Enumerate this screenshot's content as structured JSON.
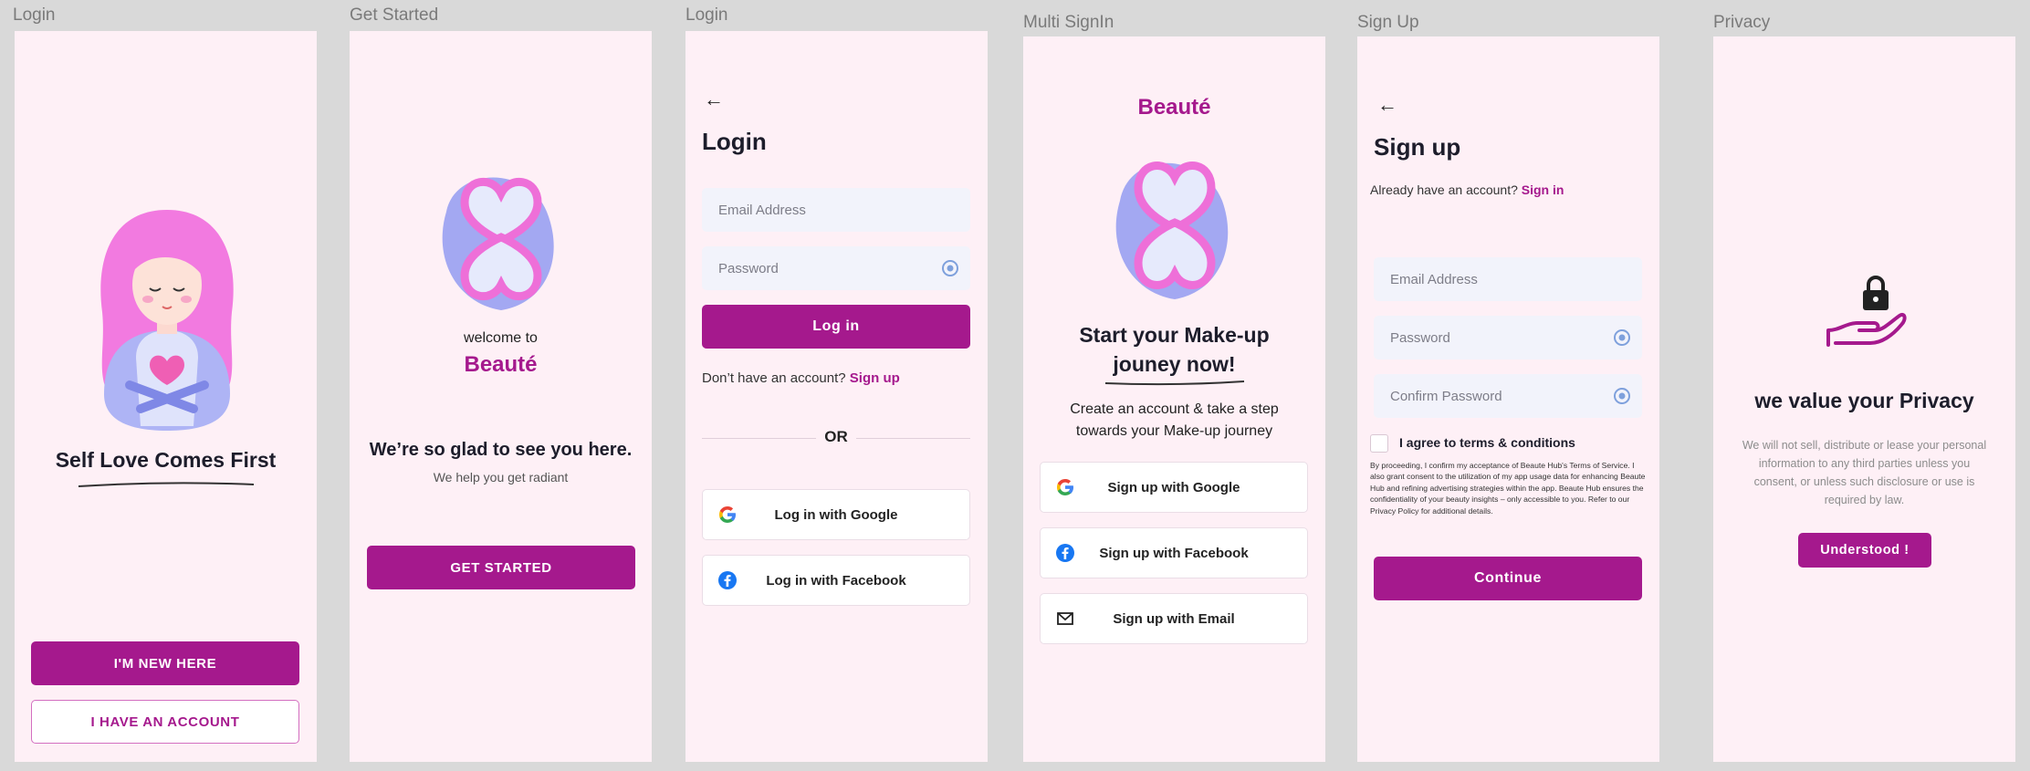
{
  "frames": {
    "f1": "Login",
    "f2": "Get Started",
    "f3": "Login",
    "f4": "Multi SignIn",
    "f5": "Sign Up",
    "f6": "Privacy"
  },
  "screen1": {
    "headline": "Self Love Comes First",
    "new_btn": "I'M NEW HERE",
    "account_btn": "I HAVE AN ACCOUNT"
  },
  "screen2": {
    "welcome": "welcome to",
    "brand": "Beauté",
    "glad": "We’re so glad to see you here.",
    "sub": "We help you get radiant",
    "cta": "GET STARTED"
  },
  "screen3": {
    "title": "Login",
    "email_placeholder": "Email Address",
    "password_placeholder": "Password",
    "login_btn": "Log in",
    "no_account": "Don’t have an account?",
    "signup_link": "Sign up",
    "or": "OR",
    "google": "Log in with Google",
    "facebook": "Log in with Facebook"
  },
  "screen4": {
    "brand": "Beauté",
    "headline1": "Start your Make-up",
    "headline2": "jouney now!",
    "sub1": "Create an account  &  take a step",
    "sub2": "towards your Make-up journey",
    "google": "Sign up with Google",
    "facebook": "Sign up with Facebook",
    "email": "Sign up with Email"
  },
  "screen5": {
    "title": "Sign up",
    "have_account": "Already have an account?",
    "signin_link": "Sign in",
    "email_placeholder": "Email Address",
    "password_placeholder": "Password",
    "confirm_placeholder": "Confirm Password",
    "terms_label": "I agree to terms & conditions",
    "terms_text": "By proceeding, I confirm my acceptance of Beaute Hub's Terms of Service. I also grant consent to the utilization of my app usage data for enhancing Beaute Hub and refining advertising strategies within the app. Beaute Hub ensures the confidentiality of your beauty insights – only accessible to you. Refer to our Privacy Policy for additional details.",
    "continue_btn": "Continue"
  },
  "screen6": {
    "title": "we value your Privacy",
    "body": "We will not sell, distribute or lease your personal information to any third parties unless you consent, or unless such disclosure or use is required by law.",
    "understood_btn": "Understood !"
  },
  "colors": {
    "brand": "#a5198d",
    "screen_bg": "#fef0f6",
    "canvas_bg": "#d9d9d9",
    "lavender": "#a3a8f2",
    "pink": "#ee6fd8"
  },
  "icons": [
    "back-arrow-icon",
    "eye-icon",
    "google-icon",
    "facebook-icon",
    "email-icon",
    "lock-hand-icon",
    "heart-logo"
  ]
}
